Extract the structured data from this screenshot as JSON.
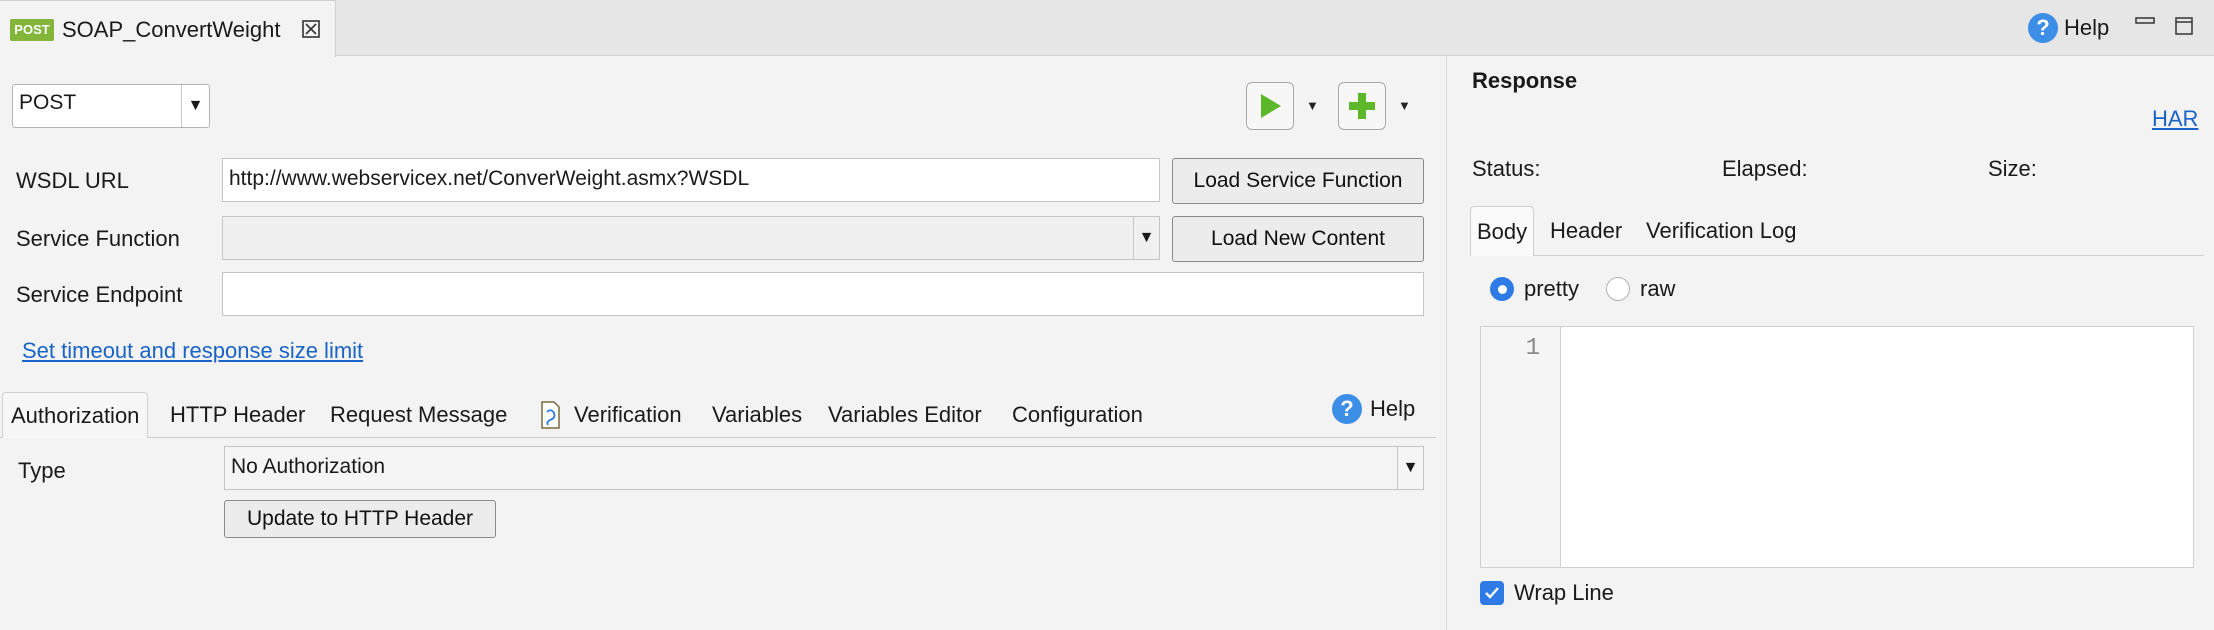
{
  "doc_tab": {
    "badge": "POST",
    "title": "SOAP_ConvertWeight"
  },
  "top_help_label": "Help",
  "method": {
    "value": "POST",
    "arrow": "▼"
  },
  "form": {
    "wsdl_label": "WSDL URL",
    "wsdl_value": "http://www.webservicex.net/ConverWeight.asmx?WSDL",
    "load_service_btn": "Load Service Function",
    "service_function_label": "Service Function",
    "service_function_value": "",
    "load_new_btn": "Load New Content",
    "endpoint_label": "Service Endpoint",
    "endpoint_value": "",
    "timeout_link": "Set timeout and response size limit"
  },
  "tabs": {
    "items": [
      "Authorization",
      "HTTP Header",
      "Request Message",
      "Verification",
      "Variables",
      "Variables Editor",
      "Configuration"
    ],
    "help_label": "Help"
  },
  "auth": {
    "type_label": "Type",
    "type_value": "No Authorization",
    "update_btn": "Update to HTTP Header"
  },
  "response": {
    "title": "Response",
    "har_link": "HAR",
    "status_label": "Status:",
    "elapsed_label": "Elapsed:",
    "size_label": "Size:",
    "tabs": [
      "Body",
      "Header",
      "Verification Log"
    ],
    "pretty_label": "pretty",
    "raw_label": "raw",
    "pretty_selected": true,
    "line_number": "1",
    "wrap_line_label": "Wrap Line",
    "wrap_line_checked": true
  },
  "colors": {
    "accent": "#2f7be6",
    "link": "#1a63c8",
    "run_green": "#5cb82a",
    "post_badge": "#82b53a"
  },
  "icons": [
    "close-icon",
    "help-icon",
    "minimize-icon",
    "maximize-icon",
    "run-icon",
    "add-icon",
    "verification-icon"
  ]
}
